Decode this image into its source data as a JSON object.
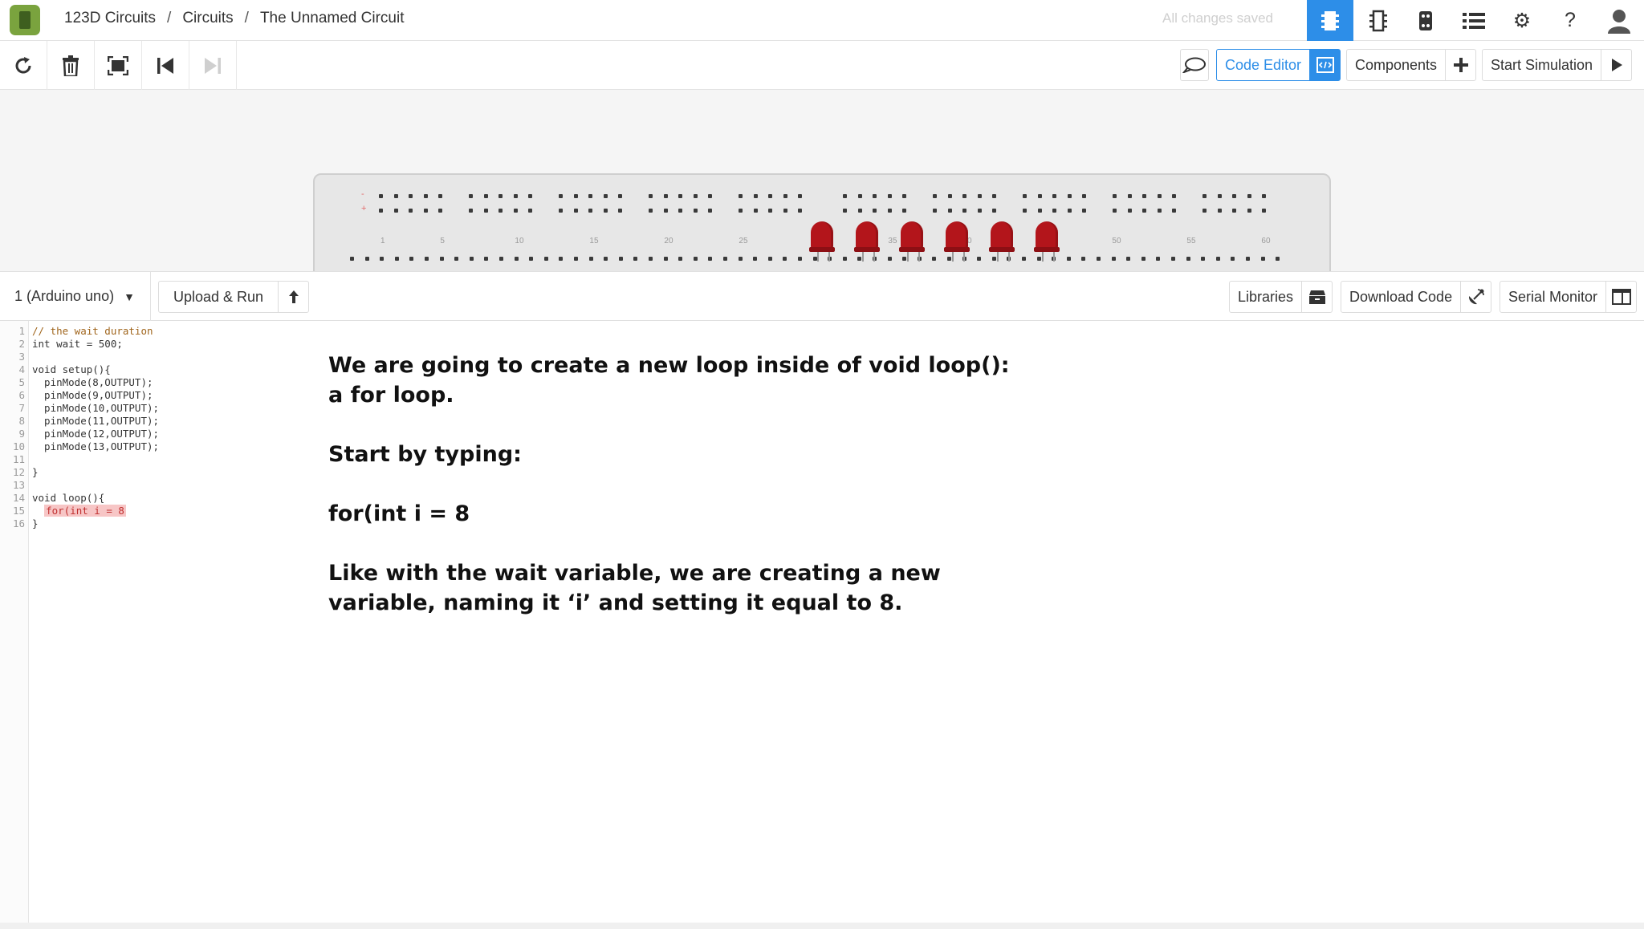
{
  "header": {
    "breadcrumb": [
      "123D Circuits",
      "Circuits",
      "The Unnamed Circuit"
    ],
    "separator": "/",
    "save_status": "All changes saved",
    "icons": [
      "breadboard-view-icon",
      "schematic-view-icon",
      "pcb-view-icon",
      "list-icon",
      "gear-icon",
      "help-icon",
      "user-avatar-icon"
    ]
  },
  "toolbar": {
    "code_editor_label": "Code Editor",
    "components_label": "Components",
    "start_simulation_label": "Start Simulation"
  },
  "breadboard": {
    "column_labels": [
      "1",
      "5",
      "10",
      "15",
      "20",
      "25",
      "30",
      "35",
      "40",
      "45",
      "50",
      "55",
      "60"
    ],
    "rail_labels": [
      "-",
      "+"
    ],
    "led_count": 6
  },
  "code_panel": {
    "board_select": "1 (Arduino uno)",
    "upload_run_label": "Upload & Run",
    "libraries_label": "Libraries",
    "download_code_label": "Download Code",
    "serial_monitor_label": "Serial Monitor"
  },
  "editor": {
    "line_numbers": [
      "1",
      "2",
      "3",
      "4",
      "5",
      "6",
      "7",
      "8",
      "9",
      "10",
      "11",
      "12",
      "13",
      "14",
      "15",
      "16"
    ],
    "lines": [
      "// the wait duration",
      "int wait = 500;",
      "",
      "void setup(){",
      "  pinMode(8,OUTPUT);",
      "  pinMode(9,OUTPUT);",
      "  pinMode(10,OUTPUT);",
      "  pinMode(11,OUTPUT);",
      "  pinMode(12,OUTPUT);",
      "  pinMode(13,OUTPUT);",
      "",
      "}",
      "",
      "void loop(){",
      "  for(int i = 8",
      "}"
    ]
  },
  "narration": {
    "para1_line1": "We are going to create a new loop inside of void loop():",
    "para1_line2": "a for loop.",
    "para2": "Start by typing:",
    "para3": "for(int i = 8",
    "para4_line1": "Like with the wait variable, we are creating a new",
    "para4_line2": "variable, naming it ‘i’ and setting it equal to 8."
  },
  "colors": {
    "accent": "#2d8ee8",
    "led": "#b3151b",
    "highlight": "#f7c6c6"
  }
}
